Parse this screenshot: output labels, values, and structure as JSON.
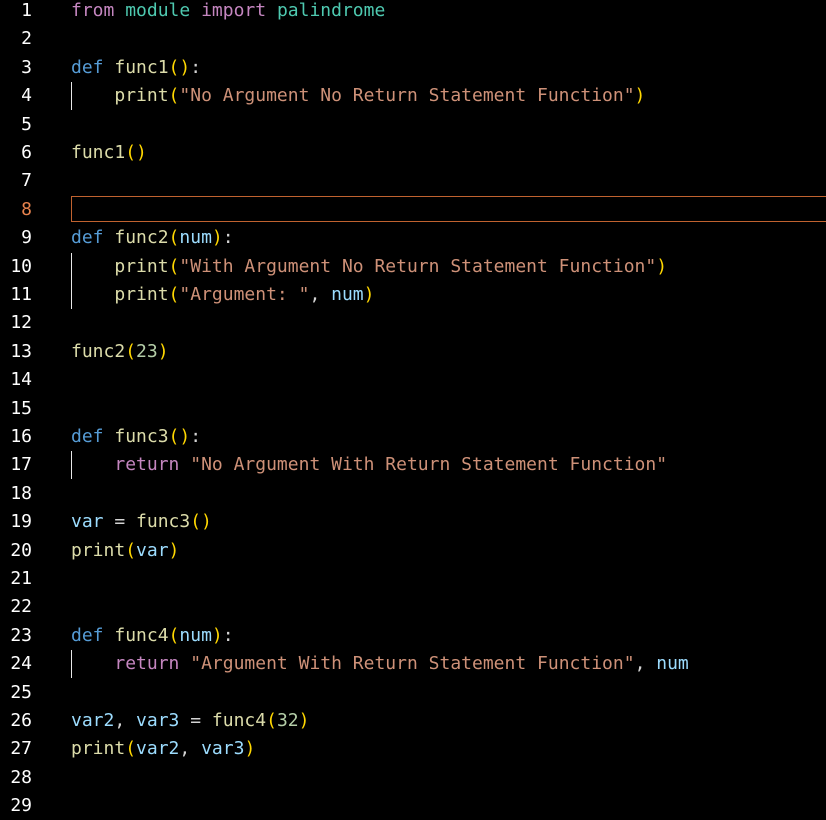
{
  "editor": {
    "active_line": 8,
    "lines": [
      {
        "n": "1",
        "tokens": [
          {
            "t": "from",
            "c": "kw-imp"
          },
          {
            "t": " ",
            "c": ""
          },
          {
            "t": "module",
            "c": "mod"
          },
          {
            "t": " ",
            "c": ""
          },
          {
            "t": "import",
            "c": "kw-imp"
          },
          {
            "t": " ",
            "c": ""
          },
          {
            "t": "palindrome",
            "c": "mod"
          }
        ]
      },
      {
        "n": "2",
        "tokens": []
      },
      {
        "n": "3",
        "tokens": [
          {
            "t": "def",
            "c": "kw"
          },
          {
            "t": " ",
            "c": ""
          },
          {
            "t": "func1",
            "c": "fn"
          },
          {
            "t": "()",
            "c": "br"
          },
          {
            "t": ":",
            "c": "pun"
          }
        ]
      },
      {
        "n": "4",
        "guide": true,
        "tokens": [
          {
            "t": "    ",
            "c": ""
          },
          {
            "t": "print",
            "c": "fn"
          },
          {
            "t": "(",
            "c": "br"
          },
          {
            "t": "\"No Argument No Return Statement Function\"",
            "c": "str"
          },
          {
            "t": ")",
            "c": "br"
          }
        ]
      },
      {
        "n": "5",
        "tokens": []
      },
      {
        "n": "6",
        "tokens": [
          {
            "t": "func1",
            "c": "fn"
          },
          {
            "t": "()",
            "c": "br"
          }
        ]
      },
      {
        "n": "7",
        "tokens": []
      },
      {
        "n": "8",
        "tokens": []
      },
      {
        "n": "9",
        "tokens": [
          {
            "t": "def",
            "c": "kw"
          },
          {
            "t": " ",
            "c": ""
          },
          {
            "t": "func2",
            "c": "fn"
          },
          {
            "t": "(",
            "c": "br"
          },
          {
            "t": "num",
            "c": "var"
          },
          {
            "t": ")",
            "c": "br"
          },
          {
            "t": ":",
            "c": "pun"
          }
        ]
      },
      {
        "n": "10",
        "guide": true,
        "tokens": [
          {
            "t": "    ",
            "c": ""
          },
          {
            "t": "print",
            "c": "fn"
          },
          {
            "t": "(",
            "c": "br"
          },
          {
            "t": "\"With Argument No Return Statement Function\"",
            "c": "str"
          },
          {
            "t": ")",
            "c": "br"
          }
        ]
      },
      {
        "n": "11",
        "guide": true,
        "tokens": [
          {
            "t": "    ",
            "c": ""
          },
          {
            "t": "print",
            "c": "fn"
          },
          {
            "t": "(",
            "c": "br"
          },
          {
            "t": "\"Argument: \"",
            "c": "str"
          },
          {
            "t": ", ",
            "c": "pun"
          },
          {
            "t": "num",
            "c": "var"
          },
          {
            "t": ")",
            "c": "br"
          }
        ]
      },
      {
        "n": "12",
        "tokens": []
      },
      {
        "n": "13",
        "tokens": [
          {
            "t": "func2",
            "c": "fn"
          },
          {
            "t": "(",
            "c": "br"
          },
          {
            "t": "23",
            "c": "num"
          },
          {
            "t": ")",
            "c": "br"
          }
        ]
      },
      {
        "n": "14",
        "tokens": []
      },
      {
        "n": "15",
        "tokens": []
      },
      {
        "n": "16",
        "tokens": [
          {
            "t": "def",
            "c": "kw"
          },
          {
            "t": " ",
            "c": ""
          },
          {
            "t": "func3",
            "c": "fn"
          },
          {
            "t": "()",
            "c": "br"
          },
          {
            "t": ":",
            "c": "pun"
          }
        ]
      },
      {
        "n": "17",
        "guide": true,
        "tokens": [
          {
            "t": "    ",
            "c": ""
          },
          {
            "t": "return",
            "c": "kw-imp"
          },
          {
            "t": " ",
            "c": ""
          },
          {
            "t": "\"No Argument With Return Statement Function\"",
            "c": "str"
          }
        ]
      },
      {
        "n": "18",
        "tokens": []
      },
      {
        "n": "19",
        "tokens": [
          {
            "t": "var",
            "c": "var"
          },
          {
            "t": " = ",
            "c": "pun"
          },
          {
            "t": "func3",
            "c": "fn"
          },
          {
            "t": "()",
            "c": "br"
          }
        ]
      },
      {
        "n": "20",
        "tokens": [
          {
            "t": "print",
            "c": "fn"
          },
          {
            "t": "(",
            "c": "br"
          },
          {
            "t": "var",
            "c": "var"
          },
          {
            "t": ")",
            "c": "br"
          }
        ]
      },
      {
        "n": "21",
        "tokens": []
      },
      {
        "n": "22",
        "tokens": []
      },
      {
        "n": "23",
        "tokens": [
          {
            "t": "def",
            "c": "kw"
          },
          {
            "t": " ",
            "c": ""
          },
          {
            "t": "func4",
            "c": "fn"
          },
          {
            "t": "(",
            "c": "br"
          },
          {
            "t": "num",
            "c": "var"
          },
          {
            "t": ")",
            "c": "br"
          },
          {
            "t": ":",
            "c": "pun"
          }
        ]
      },
      {
        "n": "24",
        "guide": true,
        "tokens": [
          {
            "t": "    ",
            "c": ""
          },
          {
            "t": "return",
            "c": "kw-imp"
          },
          {
            "t": " ",
            "c": ""
          },
          {
            "t": "\"Argument With Return Statement Function\"",
            "c": "str"
          },
          {
            "t": ", ",
            "c": "pun"
          },
          {
            "t": "num",
            "c": "var"
          }
        ]
      },
      {
        "n": "25",
        "tokens": []
      },
      {
        "n": "26",
        "tokens": [
          {
            "t": "var2",
            "c": "var"
          },
          {
            "t": ", ",
            "c": "pun"
          },
          {
            "t": "var3",
            "c": "var"
          },
          {
            "t": " = ",
            "c": "pun"
          },
          {
            "t": "func4",
            "c": "fn"
          },
          {
            "t": "(",
            "c": "br"
          },
          {
            "t": "32",
            "c": "num"
          },
          {
            "t": ")",
            "c": "br"
          }
        ]
      },
      {
        "n": "27",
        "tokens": [
          {
            "t": "print",
            "c": "fn"
          },
          {
            "t": "(",
            "c": "br"
          },
          {
            "t": "var2",
            "c": "var"
          },
          {
            "t": ", ",
            "c": "pun"
          },
          {
            "t": "var3",
            "c": "var"
          },
          {
            "t": ")",
            "c": "br"
          }
        ]
      },
      {
        "n": "28",
        "tokens": []
      },
      {
        "n": "29",
        "tokens": []
      }
    ]
  }
}
